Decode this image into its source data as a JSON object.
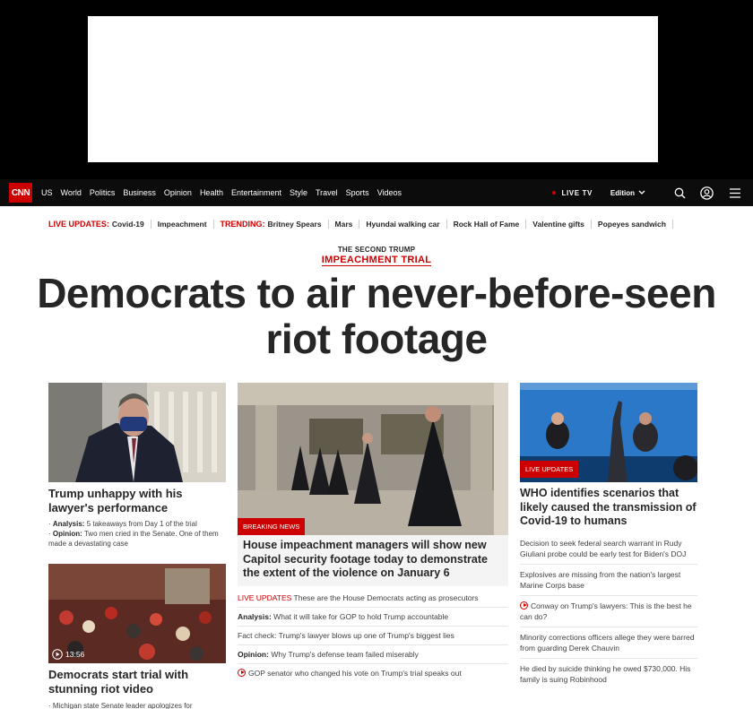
{
  "nav": {
    "logo": "CNN",
    "links": [
      "US",
      "World",
      "Politics",
      "Business",
      "Opinion",
      "Health",
      "Entertainment",
      "Style",
      "Travel",
      "Sports",
      "Videos"
    ],
    "live_tv": "LIVE TV",
    "edition": "Edition"
  },
  "trending": {
    "live_label": "LIVE UPDATES:",
    "live_items": [
      "Covid-19",
      "Impeachment"
    ],
    "trending_label": "TRENDING:",
    "trending_items": [
      "Britney Spears",
      "Mars",
      "Hyundai walking car",
      "Rock Hall of Fame",
      "Valentine gifts",
      "Popeyes sandwich"
    ]
  },
  "headline": {
    "kicker_top": "THE SECOND TRUMP",
    "kicker_main": "IMPEACHMENT TRIAL",
    "title": "Democrats to air never-before-seen riot footage"
  },
  "left": {
    "card1_title": "Trump unhappy with his lawyer's performance",
    "bullet1_label": "Analysis:",
    "bullet1_text": "5 takeaways from Day 1 of the trial",
    "bullet2_label": "Opinion:",
    "bullet2_text": "Two men cried in the Senate. One of them made a devastating case",
    "card2_video_time": "13:56",
    "card2_title": "Democrats start trial with stunning riot video",
    "card2_bullet": "Michigan state Senate leader apologizes for"
  },
  "mid": {
    "badge": "BREAKING NEWS",
    "title": "House impeachment managers will show new Capitol security footage today to demonstrate the extent of the violence on January 6",
    "link1_prefix": "LIVE UPDATES",
    "link1_text": "These are the House Democrats acting as prosecutors",
    "link2_label": "Analysis:",
    "link2_text": "What it will take for GOP to hold Trump accountable",
    "link3_text": "Fact check: Trump's lawyer blows up one of Trump's biggest lies",
    "link4_label": "Opinion:",
    "link4_text": "Why Trump's defense team failed miserably",
    "link5_text": "GOP senator who changed his vote on Trump's trial speaks out"
  },
  "right": {
    "badge": "LIVE UPDATES",
    "title": "WHO identifies scenarios that likely caused the transmission of Covid-19 to humans",
    "links": [
      "Decision to seek federal search warrant in Rudy Giuliani probe could be early test for Biden's DOJ",
      "Explosives are missing from the nation's largest Marine Corps base",
      "Conway on Trump's lawyers: This is the best he can do?",
      "Minority corrections officers allege they were barred from guarding Derek Chauvin",
      "He died by suicide thinking he owed $730,000. His family is suing Robinhood"
    ]
  }
}
